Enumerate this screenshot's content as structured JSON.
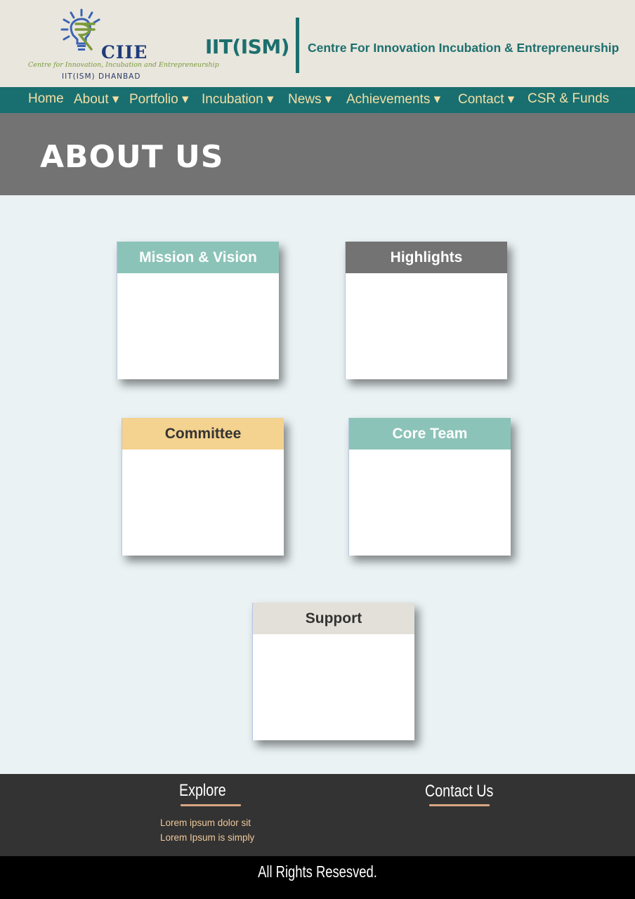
{
  "logo": {
    "acronym": "CIIE",
    "tagline": "Centre for Innovation, Incubation and Entrepreneurship",
    "location": "IIT(ISM) DHANBAD"
  },
  "brand": {
    "institute": "IIT(ISM)",
    "centre": "Centre For Innovation Incubation & Entrepreneurship"
  },
  "nav": {
    "items": [
      {
        "label": "Home"
      },
      {
        "label": "About ▾"
      },
      {
        "label": "Portfolio ▾"
      },
      {
        "label": "Incubation ▾"
      },
      {
        "label": "News ▾"
      },
      {
        "label": "Achievements ▾"
      },
      {
        "label": "Contact ▾"
      },
      {
        "label": "CSR & Funds"
      }
    ]
  },
  "banner": {
    "title": "ABOUT US"
  },
  "cards": [
    {
      "title": "Mission & Vision",
      "header_color": "#8cc3b8",
      "text_color": "#ffffff"
    },
    {
      "title": "Highlights",
      "header_color": "#737373",
      "text_color": "#ffffff"
    },
    {
      "title": "Committee",
      "header_color": "#f4d28f",
      "text_color": "#333333"
    },
    {
      "title": "Core Team",
      "header_color": "#8cc3b8",
      "text_color": "#ffffff"
    },
    {
      "title": "Support",
      "header_color": "#e2e0d8",
      "text_color": "#333333"
    }
  ],
  "footer": {
    "explore": {
      "title": "Explore",
      "links": [
        "Lorem ipsum dolor sit",
        "Lorem Ipsum is simply"
      ]
    },
    "contact": {
      "title": "Contact Us"
    },
    "accent_color": "#d8a582"
  },
  "copyright": "All Rights Resesved."
}
